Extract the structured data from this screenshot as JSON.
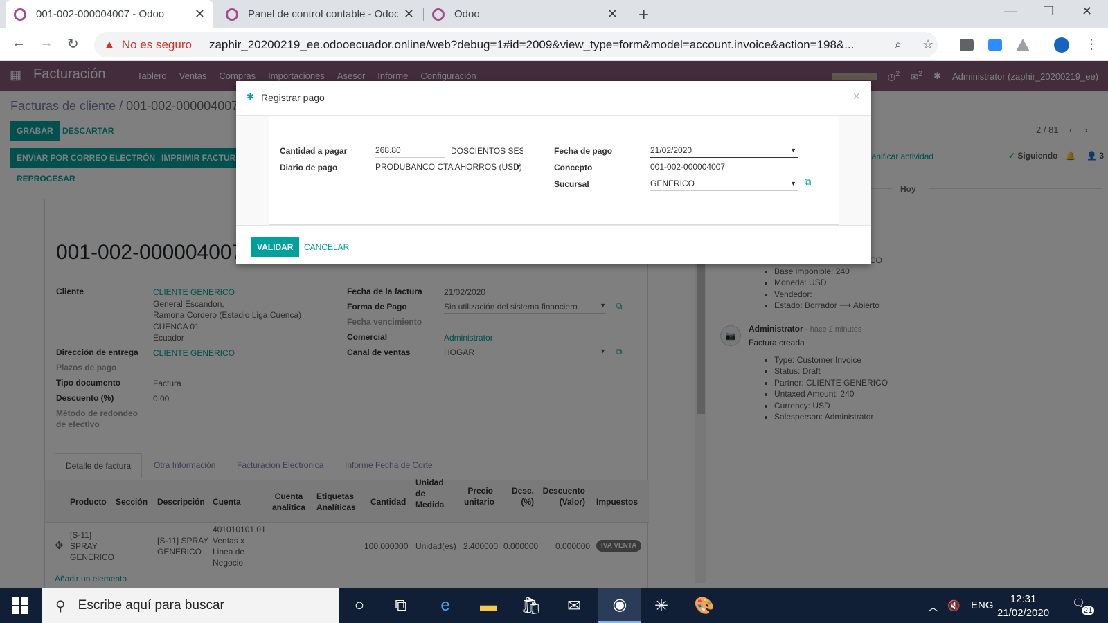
{
  "browser": {
    "tabs": [
      {
        "title": "001-002-000004007 - Odoo",
        "active": true
      },
      {
        "title": "Panel de control contable - Odoo",
        "active": false
      },
      {
        "title": "Odoo",
        "active": false
      }
    ],
    "security_label": "No es seguro",
    "url": "zaphir_20200219_ee.odooecuador.online/web?debug=1#id=2009&view_type=form&model=account.invoice&action=198&..."
  },
  "odoo_nav": {
    "brand": "Facturación",
    "menu": [
      "Tablero",
      "Ventas",
      "Compras",
      "Importaciones",
      "Asesor",
      "Informe",
      "Configuración"
    ],
    "activity_count": "2",
    "message_count": "2",
    "user": "Administrator (zaphir_20200219_ee)"
  },
  "breadcrumb": {
    "parent": "Facturas de cliente",
    "separator": "/",
    "current": "001-002-000004007"
  },
  "control": {
    "save": "GRABAR",
    "discard": "DESCARTAR",
    "send_email": "ENVIAR POR CORREO ELECTRÓNICO",
    "print_invoice": "IMPRIMIR FACTURA",
    "reprocess": "REPROCESAR",
    "pager": "2 / 81",
    "plan_activity": "lanificar actividad",
    "following": "Siguiendo",
    "followers_count": "3"
  },
  "invoice": {
    "number": "001-002-000004007",
    "customer_label": "Cliente",
    "customer": "CLIENTE GENERICO",
    "address": [
      "General Escandon,",
      "Ramona Cordero (Estadio Liga Cuenca)",
      "CUENCA 01",
      "Ecuador"
    ],
    "delivery_label": "Dirección de entrega",
    "delivery": "CLIENTE GENERICO",
    "payment_terms_label": "Plazos de pago",
    "doc_type_label": "Tipo documento",
    "doc_type": "Factura",
    "discount_label": "Descuento (%)",
    "discount": "0.00",
    "rounding_label_1": "Método de redondeo",
    "rounding_label_2": "de efectivo",
    "invoice_date_label": "Fecha de la factura",
    "invoice_date": "21/02/2020",
    "payment_form_label": "Forma de Pago",
    "payment_form": "Sin utilización del sistema financiero",
    "due_date_label": "Fecha vencimiento",
    "salesperson_label": "Comercial",
    "salesperson": "Administrator",
    "channel_label": "Canal de ventas",
    "channel": "HOGAR"
  },
  "notebook": {
    "tabs": [
      "Detalle de factura",
      "Otra Información",
      "Facturacion Electronica",
      "Informe Fecha de Corte"
    ],
    "columns": {
      "producto": "Producto",
      "seccion": "Sección",
      "descripcion": "Descripción",
      "cuenta": "Cuenta",
      "cuenta_analitica": [
        "Cuenta",
        "analitica"
      ],
      "etiquetas": [
        "Etiquetas",
        "Analíticas"
      ],
      "cantidad": "Cantidad",
      "unidad": [
        "Unidad",
        "de",
        "Medida"
      ],
      "precio": [
        "Precio",
        "unitario"
      ],
      "desc": [
        "Desc.",
        "(%)"
      ],
      "descuento": [
        "Descuento",
        "(Valor)"
      ],
      "impuestos": "Impuestos"
    },
    "row": {
      "producto": [
        "[S-11]",
        "SPRAY",
        "GENERICO"
      ],
      "descripcion": [
        "[S-11] SPRAY",
        "GENERICO"
      ],
      "cuenta": [
        "401010101.01",
        "Ventas x",
        "Linea de",
        "Negocio"
      ],
      "cantidad": "100.000000",
      "unidad": "Unidad(es)",
      "precio": "2.400000",
      "desc": "0.000000",
      "descuento": "0.000000",
      "impuesto": "IVA VENTA"
    },
    "add_line": "Añadir un elemento"
  },
  "chatter": {
    "day": "Hoy",
    "partial_value": "RICO",
    "tracking_1": [
      "Base imponible: 240",
      "Moneda: USD",
      "Vendedor:",
      "Estado: Borrador ⟶ Abierto"
    ],
    "author": "Administrator",
    "time": "- hace 2 minutos",
    "message": "Factura creada",
    "tracking_2": [
      "Type: Customer Invoice",
      "Status: Draft",
      "Partner: CLIENTE GENERICO",
      "Untaxed Amount: 240",
      "Currency: USD",
      "Salesperson: Administrator"
    ]
  },
  "modal": {
    "title": "Registrar pago",
    "amount_label": "Cantidad a pagar",
    "amount": "268.80",
    "amount_words": "DOSCIENTOS SESE",
    "journal_label": "Diario de pago",
    "journal": "PRODUBANCO CTA AHORROS (USD)",
    "date_label": "Fecha de pago",
    "date": "21/02/2020",
    "memo_label": "Concepto",
    "memo": "001-002-000004007",
    "branch_label": "Sucursal",
    "branch": "GENERICO",
    "validate": "VALIDAR",
    "cancel": "CANCELAR"
  },
  "taskbar": {
    "search_placeholder": "Escribe aquí para buscar",
    "lang": "ENG",
    "time": "12:31",
    "date": "21/02/2020",
    "notifications": "21"
  },
  "colors": {
    "odoo_primary": "#875a7b",
    "accent": "#00a09d",
    "taskbar": "#101f35"
  }
}
